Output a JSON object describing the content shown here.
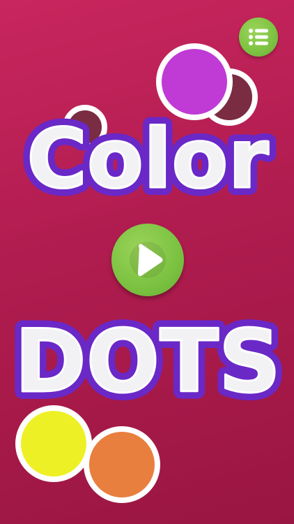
{
  "title": {
    "line1": "Color",
    "line2": "DOTS"
  },
  "buttons": {
    "menu_icon": "list-icon",
    "play_icon": "play-icon"
  },
  "colors": {
    "background": "#b81f55",
    "purple_dot": "#c03ad6",
    "maroon_dot": "#7a2c42",
    "yellow_dot": "#eef026",
    "orange_dot": "#e87f3e",
    "green_button": "#7cc241",
    "logo_outline": "#6a28c7",
    "logo_fill": "#f2f2f4"
  }
}
